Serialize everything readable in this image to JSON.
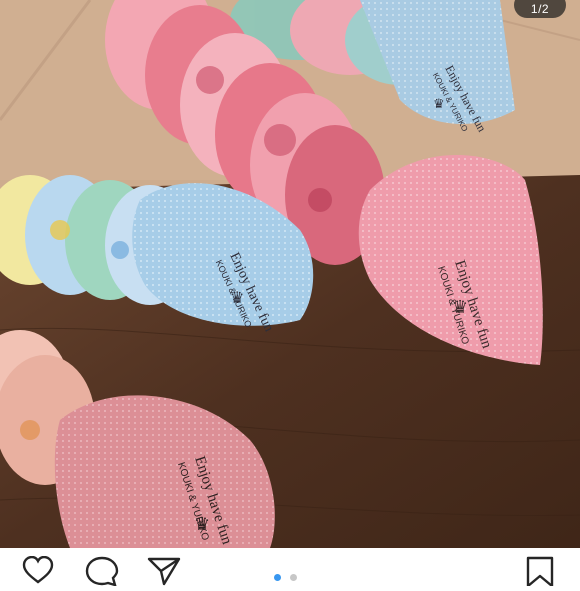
{
  "post": {
    "image_counter": "1/2",
    "cone_text": {
      "line1": "Enjoy have fun",
      "line2": "KOUKI & YURIKO"
    }
  },
  "carousel": {
    "total": 2,
    "active": 1,
    "active_color": "#3897f0",
    "inactive_color": "#c7c7c7"
  },
  "actions": {
    "like_icon": "heart-icon",
    "comment_icon": "comment-icon",
    "share_icon": "paper-plane-icon",
    "save_icon": "bookmark-icon"
  },
  "colors": {
    "pink_cone": "#ee9fae",
    "blue_cone": "#a9cfe8",
    "table": "#5a3a25",
    "tile": "#cfae8f"
  }
}
